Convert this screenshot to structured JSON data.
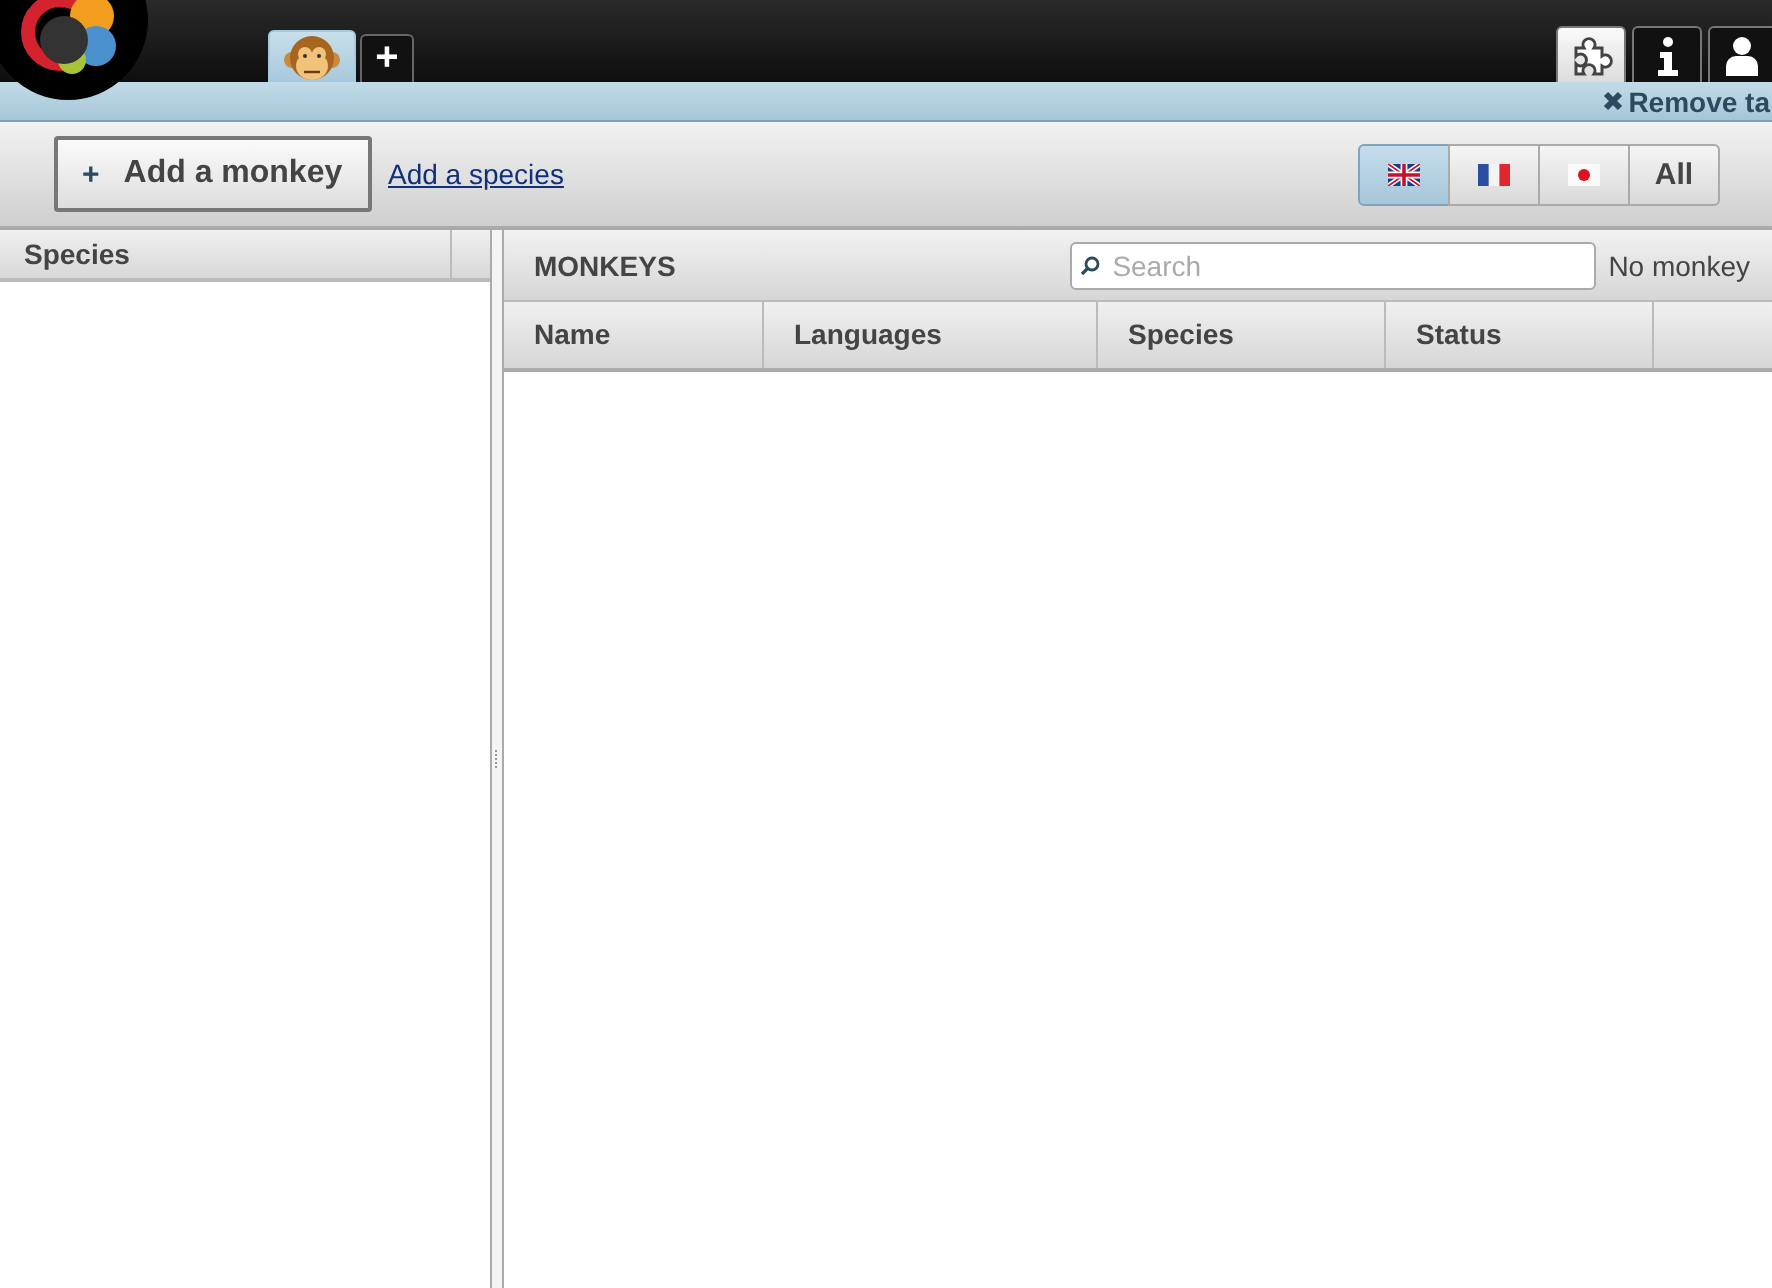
{
  "app_tabs": [
    {
      "kind": "monkey",
      "selected": true
    },
    {
      "kind": "add",
      "label": "+",
      "selected": false
    }
  ],
  "system_tabs": [
    {
      "kind": "puzzle",
      "selected": true
    },
    {
      "kind": "info",
      "selected": false
    },
    {
      "kind": "user",
      "selected": false
    }
  ],
  "remove_tab": {
    "label": "Remove ta"
  },
  "toolbar": {
    "add_button": {
      "icon": "+",
      "label": "Add a monkey"
    },
    "link": "Add a species",
    "languages": [
      {
        "kind": "uk",
        "selected": true
      },
      {
        "kind": "fr",
        "selected": false
      },
      {
        "kind": "jp",
        "selected": false
      },
      {
        "kind": "all",
        "label": "All",
        "selected": false
      }
    ]
  },
  "species_panel": {
    "header": "Species"
  },
  "monkeys_panel": {
    "title": "MONKEYS",
    "search": {
      "placeholder": "Search"
    },
    "count": "No monkey",
    "columns": [
      "Name",
      "Languages",
      "Species",
      "Status"
    ]
  }
}
